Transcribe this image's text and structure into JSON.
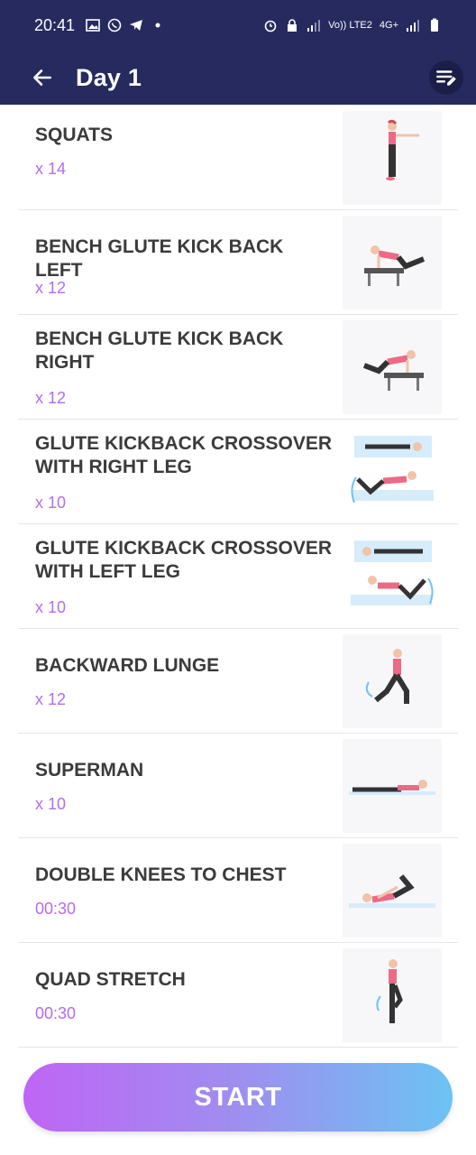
{
  "status": {
    "time": "20:41",
    "network_label": "Vo)) LTE2",
    "signal_label": "4G+"
  },
  "header": {
    "title": "Day 1"
  },
  "exercises": [
    {
      "name": "SQUATS",
      "reps": "x 14"
    },
    {
      "name": "BENCH GLUTE KICK BACK LEFT",
      "reps": "x 12"
    },
    {
      "name": "BENCH GLUTE KICK BACK RIGHT",
      "reps": "x 12"
    },
    {
      "name": "GLUTE KICKBACK CROSSOVER WITH RIGHT LEG",
      "reps": "x 10"
    },
    {
      "name": "GLUTE KICKBACK CROSSOVER WITH LEFT LEG",
      "reps": "x 10"
    },
    {
      "name": "BACKWARD LUNGE",
      "reps": "x 12"
    },
    {
      "name": "SUPERMAN",
      "reps": "x 10"
    },
    {
      "name": "DOUBLE KNEES TO CHEST",
      "reps": "00:30"
    },
    {
      "name": "QUAD STRETCH",
      "reps": "00:30"
    }
  ],
  "start_label": "START",
  "colors": {
    "header_bg": "#262a5f",
    "accent": "#b56bef",
    "gradient_start": "#bf65f5",
    "gradient_end": "#6bc3f3"
  },
  "icons": {
    "back": "arrow-left-icon",
    "edit": "edit-list-icon"
  }
}
